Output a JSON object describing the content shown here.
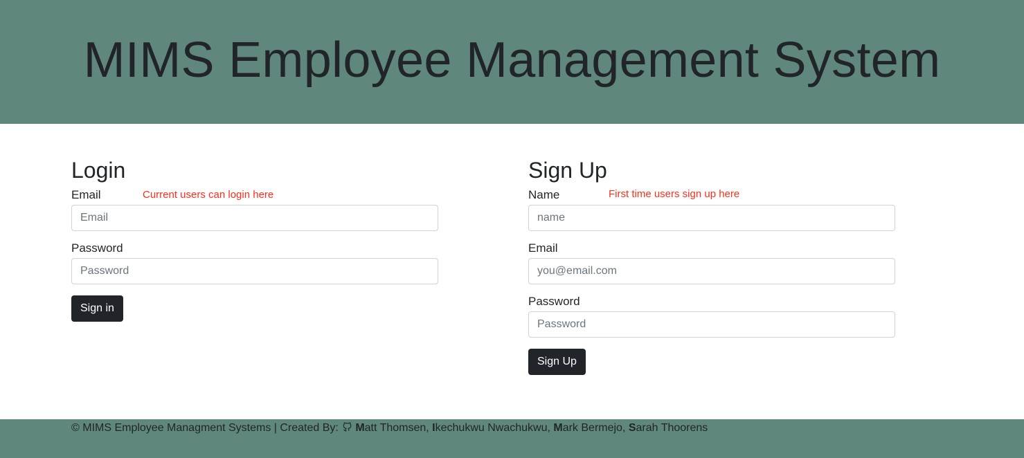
{
  "header": {
    "title": "MIMS Employee Management System"
  },
  "login": {
    "title": "Login",
    "hint": "Current users can login here",
    "email_label": "Email",
    "email_placeholder": "Email",
    "password_label": "Password",
    "password_placeholder": "Password",
    "submit_label": "Sign in"
  },
  "signup": {
    "title": "Sign Up",
    "hint": "First time users sign up here",
    "name_label": "Name",
    "name_placeholder": "name",
    "email_label": "Email",
    "email_placeholder": "you@email.com",
    "password_label": "Password",
    "password_placeholder": "Password",
    "submit_label": "Sign Up"
  },
  "footer": {
    "copyright": "© MIMS Employee Managment Systems | Created By: ",
    "icon": "github-icon",
    "authors": [
      {
        "initial": "M",
        "rest": "att Thomsen"
      },
      {
        "initial": "I",
        "rest": "kechukwu Nwachukwu"
      },
      {
        "initial": "M",
        "rest": "ark Bermejo"
      },
      {
        "initial": "S",
        "rest": "arah Thoorens"
      }
    ],
    "separator": ", "
  },
  "colors": {
    "header_bg": "#5f877e",
    "footer_bg": "#5f877e",
    "hint": "#ff2d1a",
    "button_bg": "#212529"
  }
}
